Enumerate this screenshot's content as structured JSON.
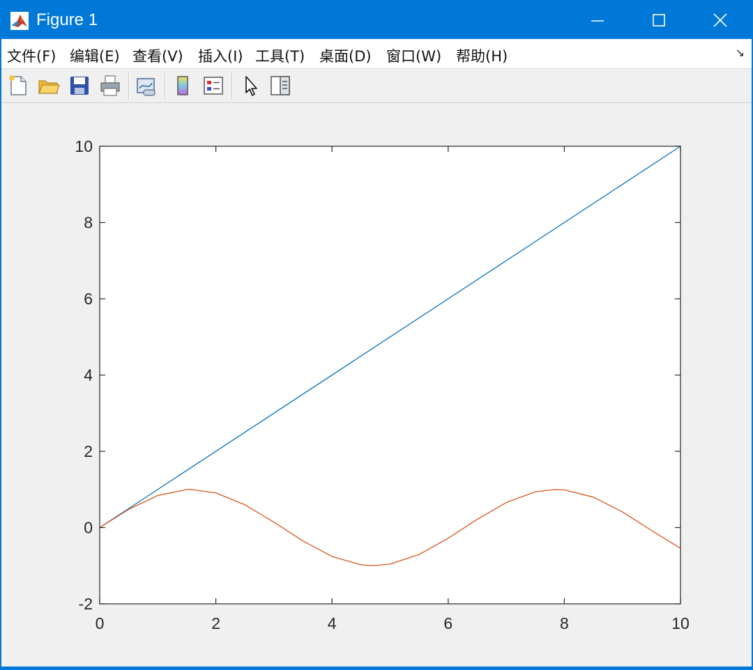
{
  "window": {
    "title": "Figure 1"
  },
  "menu": {
    "items": [
      "文件(F)",
      "编辑(E)",
      "查看(V)",
      "插入(I)",
      "工具(T)",
      "桌面(D)",
      "窗口(W)",
      "帮助(H)"
    ],
    "overflow_icon": "dock-arrow-icon"
  },
  "toolbar": {
    "icons": [
      "new-figure-icon",
      "open-file-icon",
      "save-icon",
      "print-icon",
      "link-plot-icon",
      "insert-colorbar-icon",
      "insert-legend-icon",
      "edit-plot-arrow-icon",
      "property-inspector-icon"
    ]
  },
  "chart_data": {
    "type": "line",
    "x_range": [
      0,
      10
    ],
    "ylim": [
      -2,
      10
    ],
    "xticks": [
      0,
      2,
      4,
      6,
      8,
      10
    ],
    "yticks": [
      -2,
      0,
      2,
      4,
      6,
      8,
      10
    ],
    "series": [
      {
        "color": "#0072bd",
        "x": [
          0,
          10
        ],
        "y": [
          0,
          10
        ],
        "description": "y = x"
      },
      {
        "color": "#d95319",
        "x": [
          0,
          0.5,
          1,
          1.5,
          1.57,
          2,
          2.5,
          3,
          3.5,
          4,
          4.5,
          4.71,
          5,
          5.5,
          6,
          6.5,
          7,
          7.5,
          7.85,
          8,
          8.5,
          9,
          9.5,
          10
        ],
        "y": [
          0,
          0.479,
          0.841,
          0.997,
          1.0,
          0.909,
          0.598,
          0.141,
          -0.351,
          -0.757,
          -0.977,
          -1.0,
          -0.959,
          -0.706,
          -0.279,
          0.215,
          0.657,
          0.938,
          1.0,
          0.989,
          0.798,
          0.412,
          -0.075,
          -0.544
        ],
        "description": "y = sin(x)"
      }
    ],
    "grid": false,
    "legend": "none",
    "title": "",
    "xlabel": "",
    "ylabel": ""
  }
}
